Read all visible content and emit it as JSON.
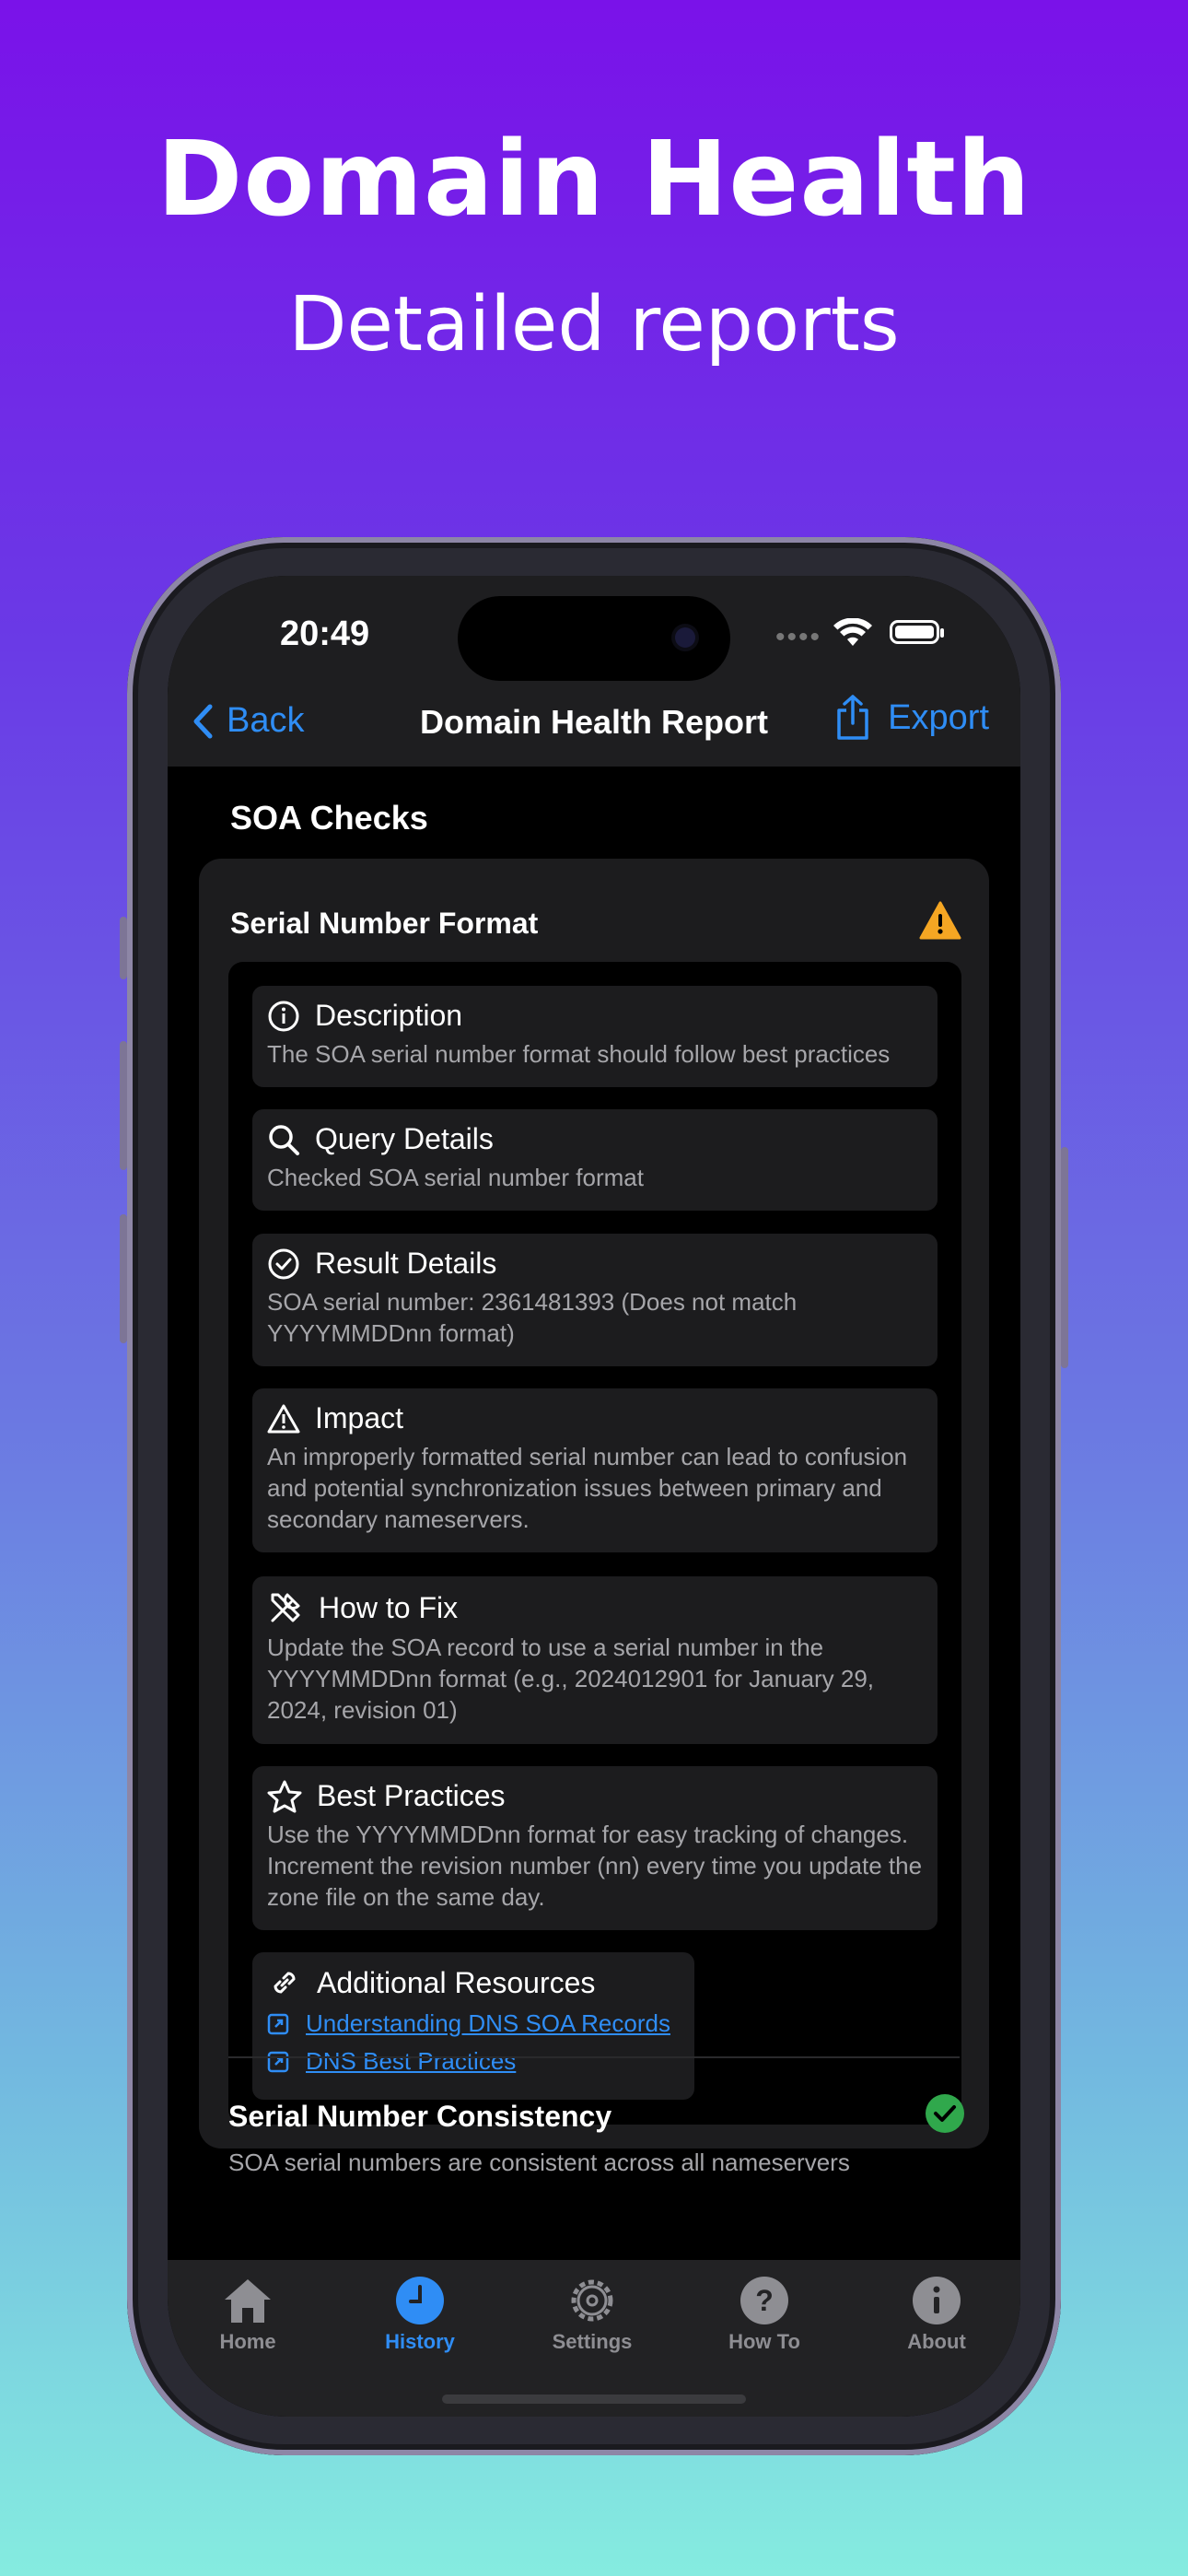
{
  "hero": {
    "title": "Domain Health",
    "subtitle": "Detailed reports"
  },
  "status": {
    "time": "20:49"
  },
  "nav": {
    "back": "Back",
    "title": "Domain Health Report",
    "export": "Export"
  },
  "section": {
    "title": "SOA Checks"
  },
  "check1": {
    "title": "Serial Number Format",
    "status_icon": "warning-icon",
    "details": [
      {
        "icon": "info-icon",
        "title": "Description",
        "body": "The SOA serial number format should follow best practices"
      },
      {
        "icon": "magnifier-icon",
        "title": "Query Details",
        "body": "Checked SOA serial number format"
      },
      {
        "icon": "checkmark-circle-icon",
        "title": "Result Details",
        "body": "SOA serial number: 2361481393 (Does not match YYYYMMDDnn format)"
      },
      {
        "icon": "warning-triangle-icon",
        "title": "Impact",
        "body": "An improperly formatted serial number can lead to confusion and potential synchronization issues between primary and secondary nameservers."
      },
      {
        "icon": "tools-icon",
        "title": "How to Fix",
        "body": "Update the SOA record to use a serial number in the YYYYMMDDnn format (e.g., 2024012901 for January 29, 2024, revision 01)"
      },
      {
        "icon": "star-icon",
        "title": "Best Practices",
        "body": "Use the YYYYMMDDnn format for easy tracking of changes. Increment the revision number (nn) every time you update the zone file on the same day."
      }
    ],
    "resources": {
      "title": "Additional Resources",
      "links": [
        "Understanding DNS SOA Records",
        "DNS Best Practices"
      ]
    }
  },
  "check2": {
    "title": "Serial Number Consistency",
    "desc": "SOA serial numbers are consistent across all nameservers"
  },
  "tabs": [
    {
      "label": "Home",
      "icon": "house-icon"
    },
    {
      "label": "History",
      "icon": "clock-icon",
      "active": true
    },
    {
      "label": "Settings",
      "icon": "gear-icon"
    },
    {
      "label": "How To",
      "icon": "question-icon"
    },
    {
      "label": "About",
      "icon": "info-circle-icon"
    }
  ],
  "colors": {
    "accent": "#2f8df5",
    "warning": "#f5a623",
    "success": "#30a84c"
  }
}
